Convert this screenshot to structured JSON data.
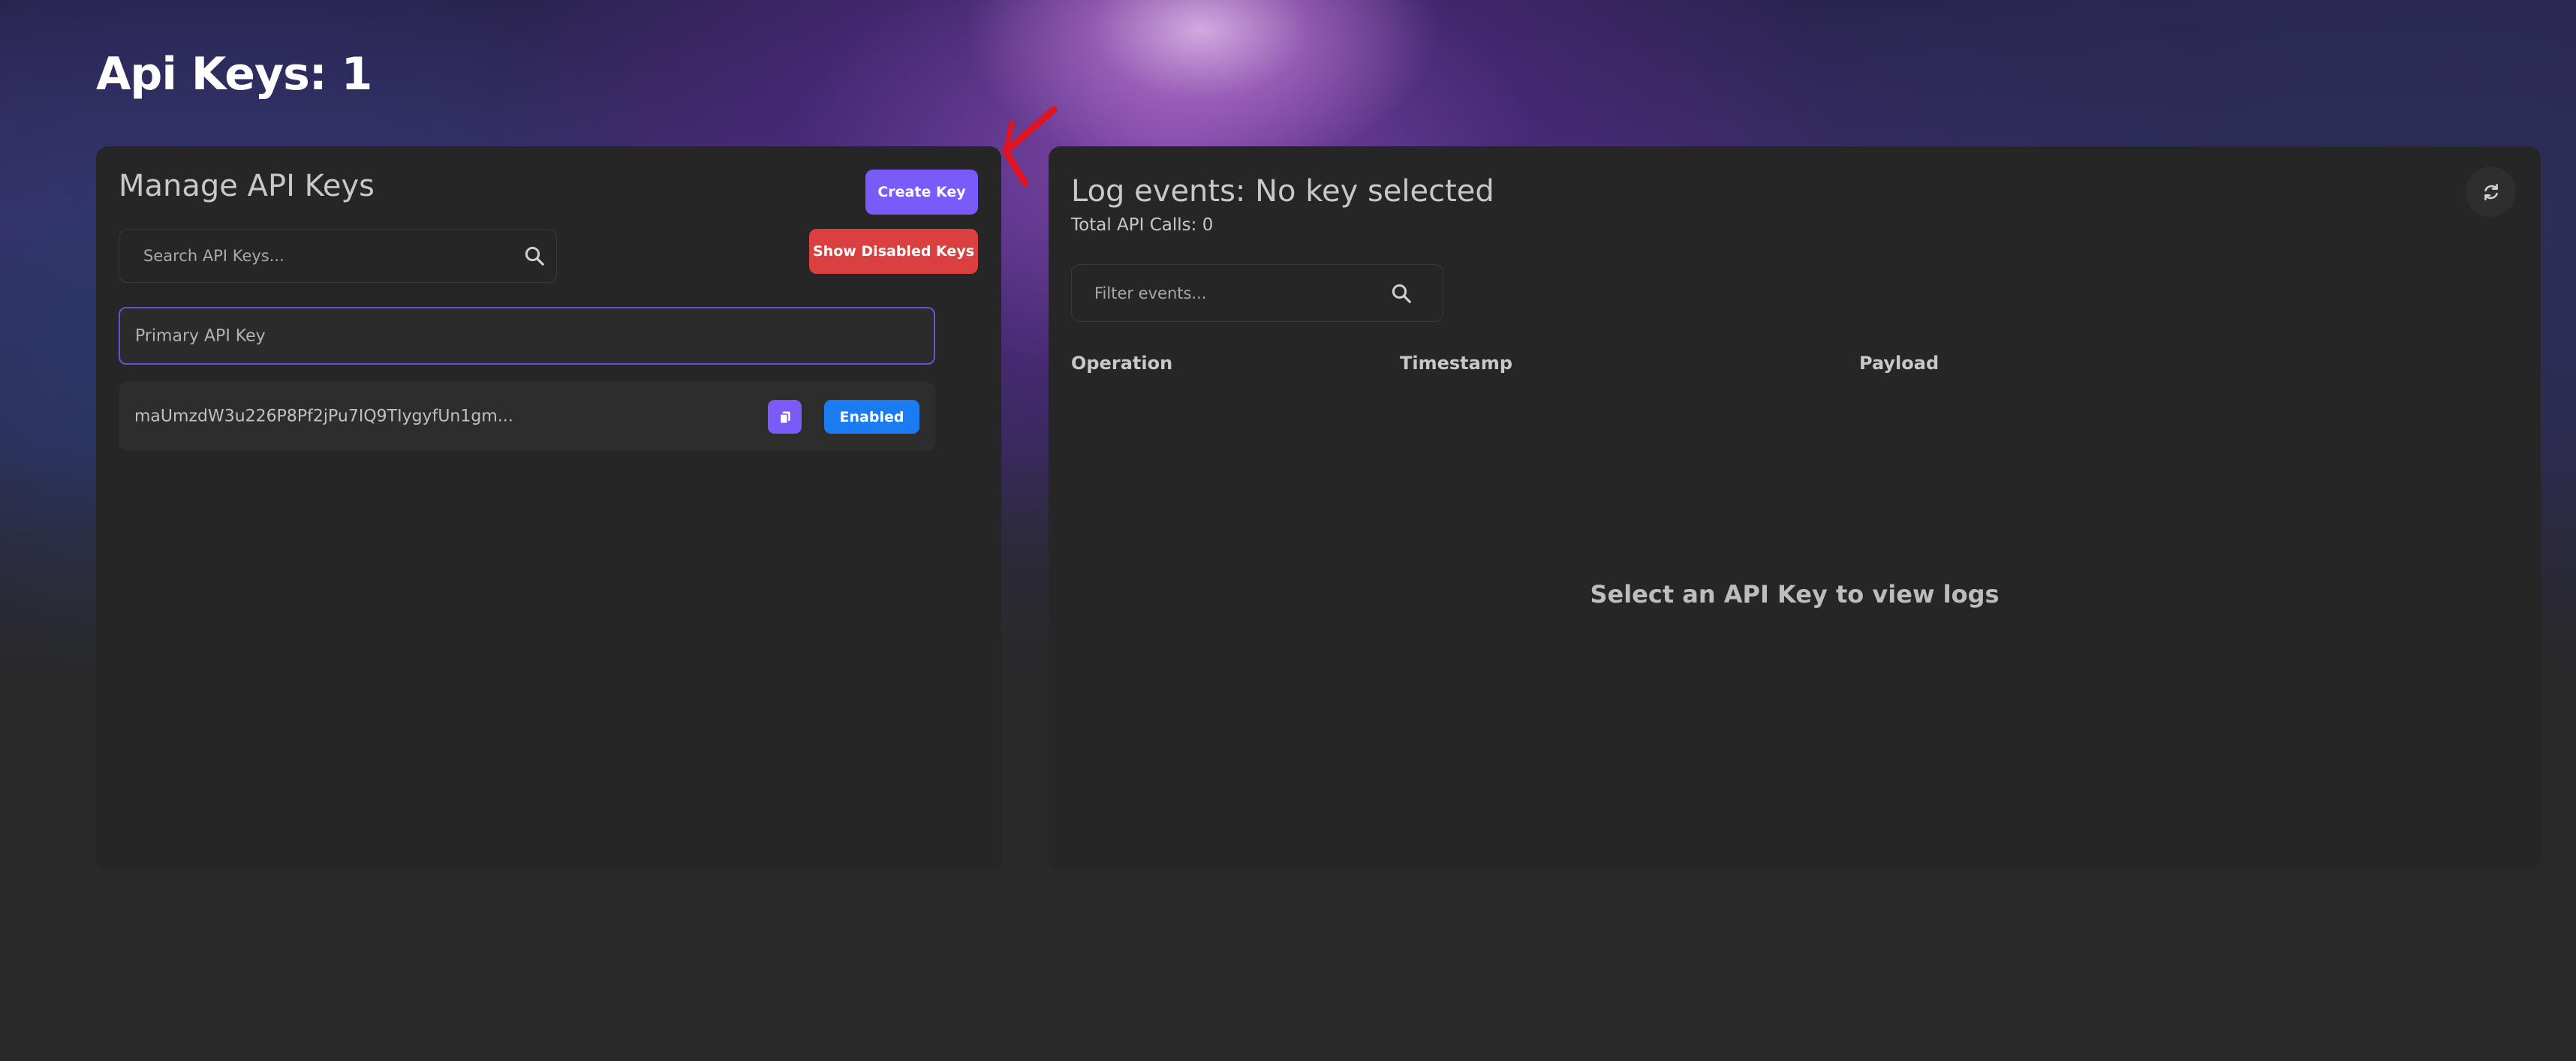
{
  "page": {
    "heading": "Api Keys: 1"
  },
  "left_panel": {
    "title": "Manage API Keys",
    "create_button_label": "Create Key",
    "show_disabled_button_label": "Show Disabled Keys",
    "search_placeholder": "Search API Keys...",
    "key_name_value": "Primary API Key",
    "keys": [
      {
        "key_text": "maUmzdW3u226P8Pf2jPu7IQ9TIygyfUn1gm...",
        "status_label": "Enabled"
      }
    ]
  },
  "right_panel": {
    "title": "Log events: No key selected",
    "total_calls": "Total API Calls: 0",
    "filter_placeholder": "Filter events...",
    "columns": [
      "Operation",
      "Timestamp",
      "Payload"
    ],
    "empty_message": "Select an API Key to view logs"
  },
  "icons": {
    "search": "search-icon",
    "copy": "copy-icon",
    "refresh": "refresh-icon"
  },
  "colors": {
    "accent_purple": "#7a5af8",
    "danger_red": "#d9403f",
    "enabled_blue": "#1a7cf0",
    "panel_bg": "#262626",
    "page_bg": "#292929"
  }
}
